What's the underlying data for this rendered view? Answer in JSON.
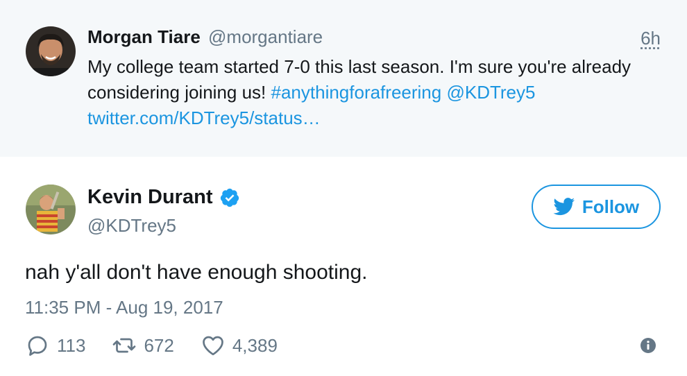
{
  "parent_tweet": {
    "name": "Morgan Tiare",
    "handle": "@morgantiare",
    "time": "6h",
    "text_plain": "My college team started 7-0 this last season. I'm sure you're already considering joining us! ",
    "hashtag": "#anythingforafreering",
    "mention": "@KDTrey5",
    "link": "twitter.com/KDTrey5/status…"
  },
  "main_tweet": {
    "name": "Kevin Durant",
    "handle": "@KDTrey5",
    "follow_label": "Follow",
    "text": "nah y'all don't have enough shooting.",
    "timestamp": "11:35 PM - Aug 19, 2017",
    "replies": "113",
    "retweets": "672",
    "likes": "4,389"
  },
  "colors": {
    "accent": "#1b95e0",
    "verified": "#1da1f2",
    "muted": "#657786",
    "parent_bg": "#f5f8fa"
  },
  "icons": {
    "verified": "verified-badge-icon",
    "follow": "bird-icon",
    "reply": "reply-icon",
    "retweet": "retweet-icon",
    "like": "heart-icon",
    "info": "info-icon"
  }
}
